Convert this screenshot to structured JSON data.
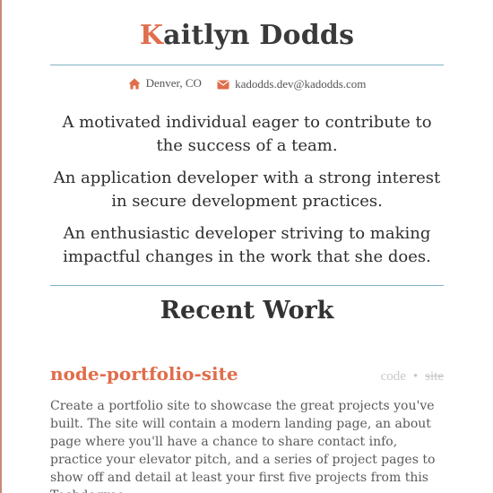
{
  "header": {
    "name_initial": "K",
    "name_rest": "aitlyn Dodds"
  },
  "contact": {
    "location": "Denver, CO",
    "email": "kadodds.dev@kadodds.com",
    "location_icon": "home-icon",
    "email_icon": "envelope-icon"
  },
  "bio": [
    "A motivated individual eager to contribute to the success of a team.",
    "An application developer with a strong interest in secure development practices.",
    "An enthusiastic developer striving to making impactful changes in the work that she does."
  ],
  "recent_work": {
    "title": "Recent Work",
    "projects": [
      {
        "title": "node-portfolio-site",
        "code_label": "code",
        "separator": "•",
        "site_label": "site",
        "description": "Create a portfolio site to showcase the great projects you've built. The site will contain a modern landing page, an about page where you'll have a chance to share contact info, practice your elevator pitch, and a series of project pages to show off and detail at least your first five projects from this Techdegree."
      }
    ]
  },
  "colors": {
    "accent": "#e06d4b",
    "rule": "#7fb0c6",
    "muted_link": "#c8c8c8"
  }
}
